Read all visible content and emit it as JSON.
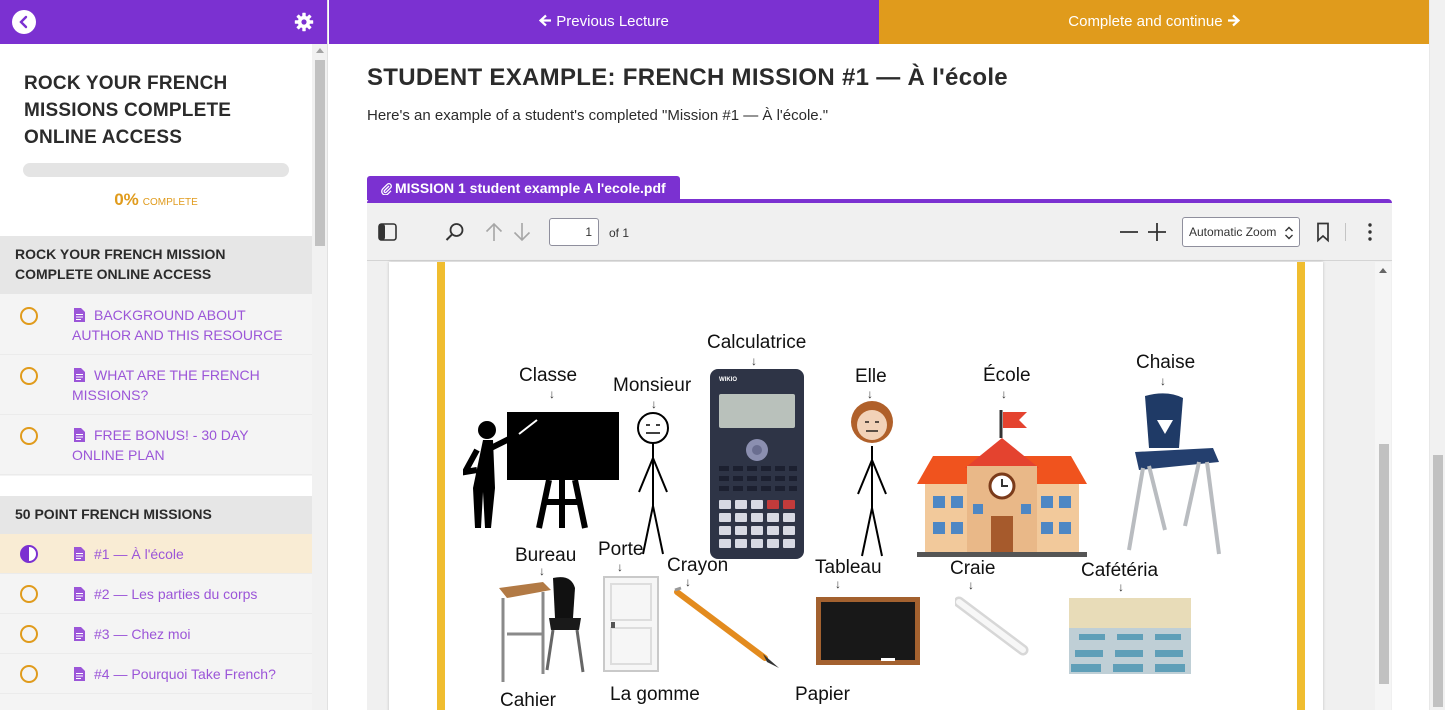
{
  "sidebar": {
    "course_title": "ROCK YOUR FRENCH MISSIONS COMPLETE ONLINE ACCESS",
    "progress_percent": "0%",
    "progress_value": 0,
    "progress_word": "COMPLETE",
    "sections": [
      {
        "title": "ROCK YOUR FRENCH MISSION COMPLETE ONLINE ACCESS",
        "lectures": [
          {
            "label": "BACKGROUND ABOUT AUTHOR AND THIS RESOURCE",
            "status": "not-started"
          },
          {
            "label": "WHAT ARE THE FRENCH MISSIONS?",
            "status": "not-started"
          },
          {
            "label": "FREE BONUS! - 30 DAY ONLINE PLAN",
            "status": "not-started"
          }
        ]
      },
      {
        "title": "50 POINT FRENCH MISSIONS",
        "lectures": [
          {
            "label": "#1 — À l'école",
            "status": "in-progress"
          },
          {
            "label": "#2 — Les parties du corps",
            "status": "not-started"
          },
          {
            "label": "#3 — Chez moi",
            "status": "not-started"
          },
          {
            "label": "#4 — Pourquoi Take French?",
            "status": "not-started"
          }
        ]
      }
    ]
  },
  "nav": {
    "prev_label": "Previous Lecture",
    "next_label": "Complete and continue"
  },
  "lecture": {
    "title": "STUDENT EXAMPLE: FRENCH MISSION #1 — À l'école",
    "description": "Here's an example of a student's completed \"Mission #1 — À l'école.\""
  },
  "attachment": {
    "filename": "MISSION 1 student example A l'ecole.pdf"
  },
  "pdf_viewer": {
    "page_number": "1",
    "page_count": "of 1",
    "zoom": "Automatic Zoom"
  },
  "pdf_content": {
    "words": {
      "calculatrice": "Calculatrice",
      "classe": "Classe",
      "monsieur": "Monsieur",
      "elle": "Elle",
      "ecole": "École",
      "chaise": "Chaise",
      "bureau": "Bureau",
      "porte": "Porte",
      "crayon": "Crayon",
      "tableau": "Tableau",
      "craie": "Craie",
      "cafeteria": "Cafétéria",
      "cahier": "Cahier",
      "la_gomme": "La gomme",
      "papier": "Papier"
    },
    "calculator_brand": "WIKIO"
  },
  "colors": {
    "purple": "#7b31d1",
    "gold": "#e09b1c",
    "page_border": "#f0bd2f"
  }
}
